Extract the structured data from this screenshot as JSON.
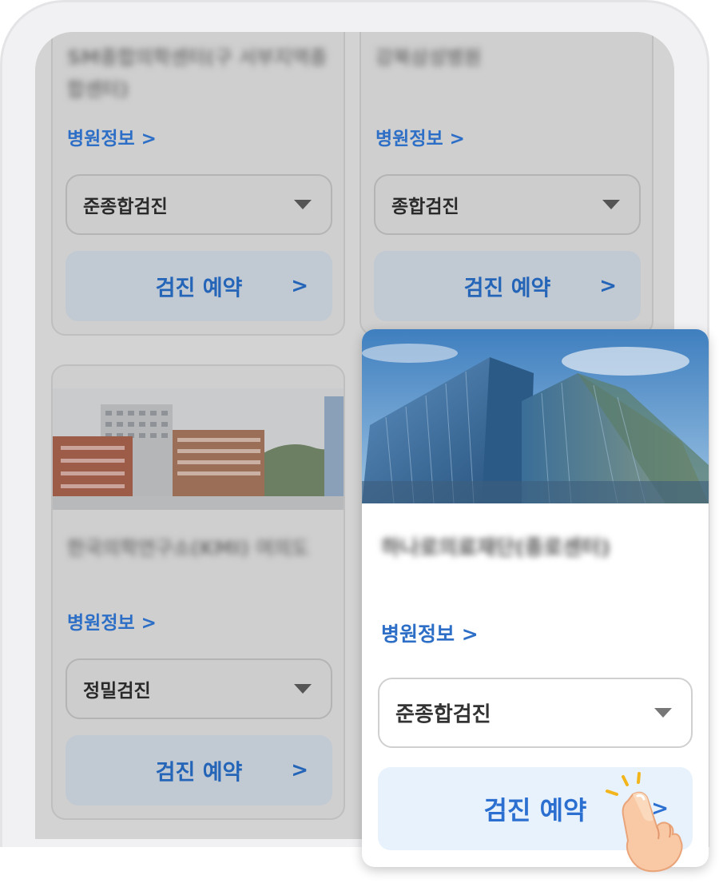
{
  "cards": [
    {
      "hospital_name": "SM종합의학센터(구 서부지역종합센터)",
      "info_link": "병원정보 >",
      "exam_type": "준종합검진",
      "book_label": "검진 예약",
      "book_chevron": ">"
    },
    {
      "hospital_name": "강북삼성병원",
      "info_link": "병원정보 >",
      "exam_type": "종합검진",
      "book_label": "검진 예약",
      "book_chevron": ">"
    },
    {
      "hospital_name": "한국의학연구소(KMI) 여의도",
      "info_link": "병원정보 >",
      "exam_type": "정밀검진",
      "book_label": "검진 예약",
      "book_chevron": ">"
    }
  ],
  "highlight_card": {
    "hospital_name": "하나로의료재단(종로센터)",
    "info_link": "병원정보 >",
    "exam_type": "준종합검진",
    "book_label": "검진 예약",
    "book_chevron": ">"
  }
}
